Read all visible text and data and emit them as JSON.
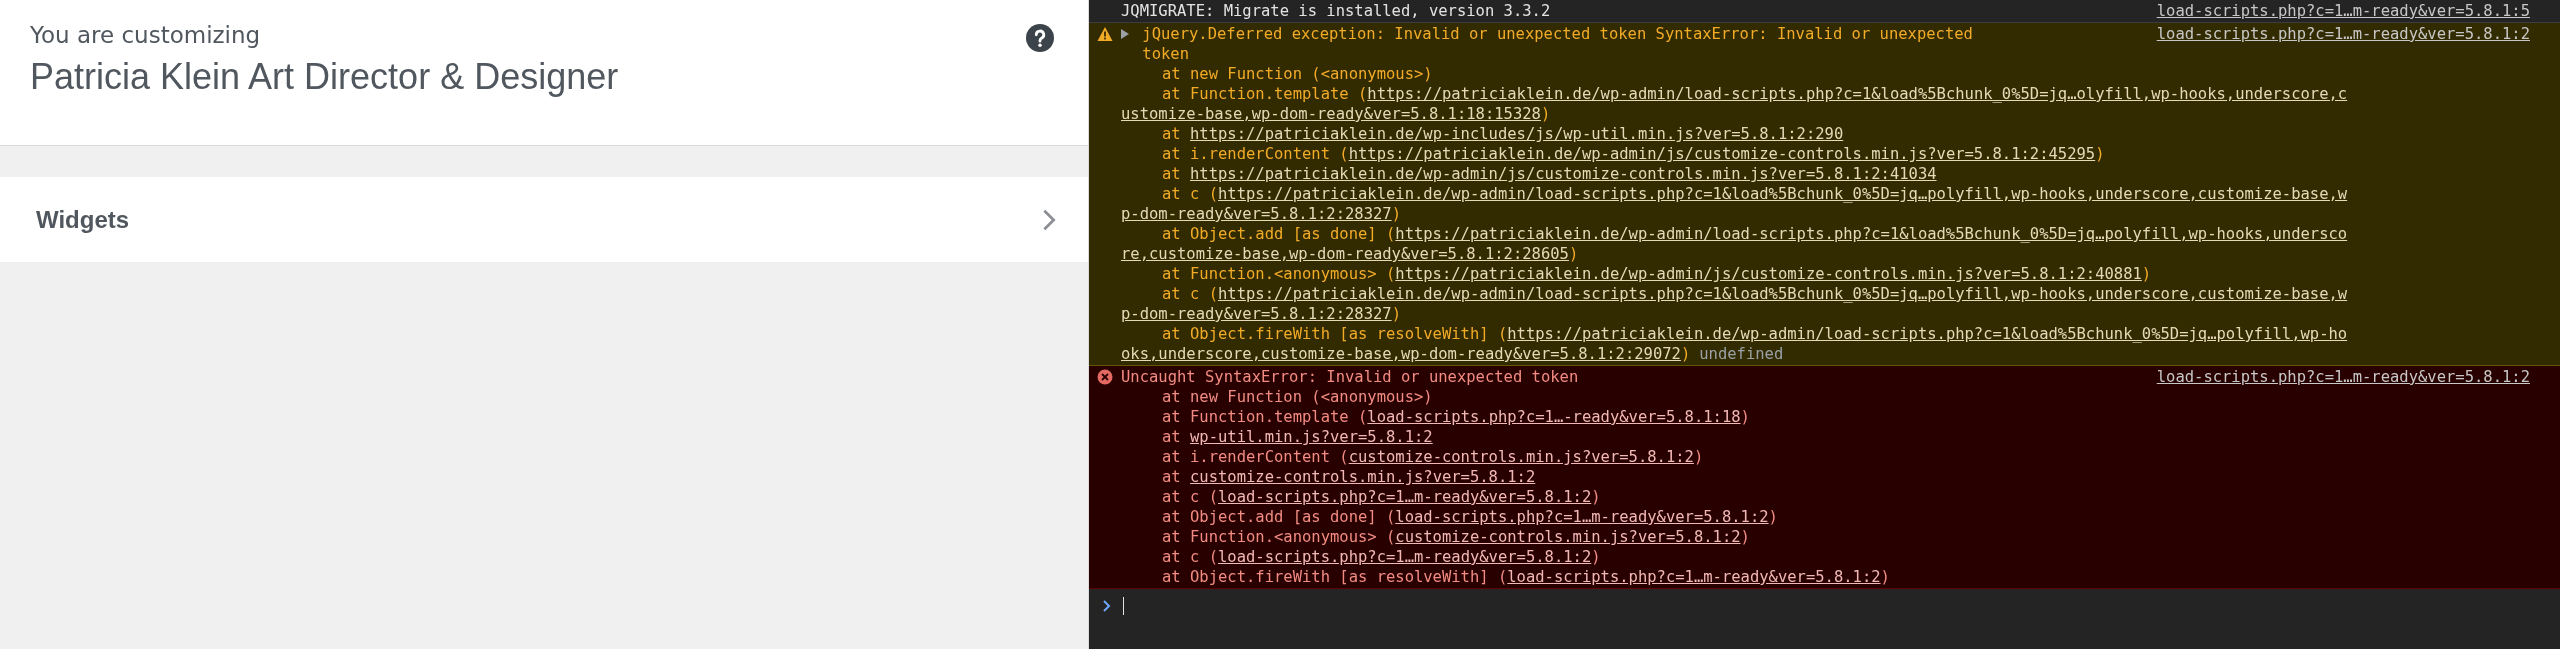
{
  "customizer": {
    "subtitle": "You are customizing",
    "site_title": "Patricia Klein Art Director & Designer",
    "sections": [
      {
        "label": "Widgets"
      }
    ]
  },
  "console": {
    "messages": [
      {
        "kind": "info",
        "text": "JQMIGRATE: Migrate is installed, version 3.3.2",
        "source": "load-scripts.php?c=1…m-ready&ver=5.8.1:5"
      },
      {
        "kind": "warning",
        "expanded": false,
        "text": "jQuery.Deferred exception: Invalid or unexpected token SyntaxError: Invalid or unexpected token",
        "source": "load-scripts.php?c=1…m-ready&ver=5.8.1:2",
        "note": "undefined",
        "frames": [
          {
            "before": "at new Function (<anonymous>)"
          },
          {
            "before": "at Function.template (",
            "link": "https://patriciaklein.de/wp-admin/load-scripts.php?c=1&load%5Bchunk_0%5D=jq…olyfill,wp-hooks,underscore,c",
            "link_cont": "ustomize-base,wp-dom-ready&ver=5.8.1:18:15328",
            "after": ")"
          },
          {
            "before": "at ",
            "link": "https://patriciaklein.de/wp-includes/js/wp-util.min.js?ver=5.8.1:2:290"
          },
          {
            "before": "at i.renderContent (",
            "link": "https://patriciaklein.de/wp-admin/js/customize-controls.min.js?ver=5.8.1:2:45295",
            "after": ")"
          },
          {
            "before": "at ",
            "link": "https://patriciaklein.de/wp-admin/js/customize-controls.min.js?ver=5.8.1:2:41034"
          },
          {
            "before": "at c (",
            "link": "https://patriciaklein.de/wp-admin/load-scripts.php?c=1&load%5Bchunk_0%5D=jq…polyfill,wp-hooks,underscore,customize-base,w",
            "link_cont": "p-dom-ready&ver=5.8.1:2:28327",
            "after": ")"
          },
          {
            "before": "at Object.add [as done] (",
            "link": "https://patriciaklein.de/wp-admin/load-scripts.php?c=1&load%5Bchunk_0%5D=jq…polyfill,wp-hooks,undersco",
            "link_cont": "re,customize-base,wp-dom-ready&ver=5.8.1:2:28605",
            "after": ")"
          },
          {
            "before": "at Function.<anonymous> (",
            "link": "https://patriciaklein.de/wp-admin/js/customize-controls.min.js?ver=5.8.1:2:40881",
            "after": ")"
          },
          {
            "before": "at c (",
            "link": "https://patriciaklein.de/wp-admin/load-scripts.php?c=1&load%5Bchunk_0%5D=jq…polyfill,wp-hooks,underscore,customize-base,w",
            "link_cont": "p-dom-ready&ver=5.8.1:2:28327",
            "after": ")"
          },
          {
            "before": "at Object.fireWith [as resolveWith] (",
            "link": "https://patriciaklein.de/wp-admin/load-scripts.php?c=1&load%5Bchunk_0%5D=jq…polyfill,wp-ho",
            "link_cont": "oks,underscore,customize-base,wp-dom-ready&ver=5.8.1:2:29072",
            "after": ")"
          }
        ]
      },
      {
        "kind": "error",
        "text": "Uncaught SyntaxError: Invalid or unexpected token",
        "source": "load-scripts.php?c=1…m-ready&ver=5.8.1:2",
        "frames": [
          {
            "before": "at new Function (<anonymous>)"
          },
          {
            "before": "at Function.template (",
            "link": "load-scripts.php?c=1…-ready&ver=5.8.1:18",
            "after": ")"
          },
          {
            "before": "at ",
            "link": "wp-util.min.js?ver=5.8.1:2"
          },
          {
            "before": "at i.renderContent (",
            "link": "customize-controls.min.js?ver=5.8.1:2",
            "after": ")"
          },
          {
            "before": "at ",
            "link": "customize-controls.min.js?ver=5.8.1:2"
          },
          {
            "before": "at c (",
            "link": "load-scripts.php?c=1…m-ready&ver=5.8.1:2",
            "after": ")"
          },
          {
            "before": "at Object.add [as done] (",
            "link": "load-scripts.php?c=1…m-ready&ver=5.8.1:2",
            "after": ")"
          },
          {
            "before": "at Function.<anonymous> (",
            "link": "customize-controls.min.js?ver=5.8.1:2",
            "after": ")"
          },
          {
            "before": "at c (",
            "link": "load-scripts.php?c=1…m-ready&ver=5.8.1:2",
            "after": ")"
          },
          {
            "before": "at Object.fireWith [as resolveWith] (",
            "link": "load-scripts.php?c=1…m-ready&ver=5.8.1:2",
            "after": ")"
          }
        ]
      }
    ]
  }
}
